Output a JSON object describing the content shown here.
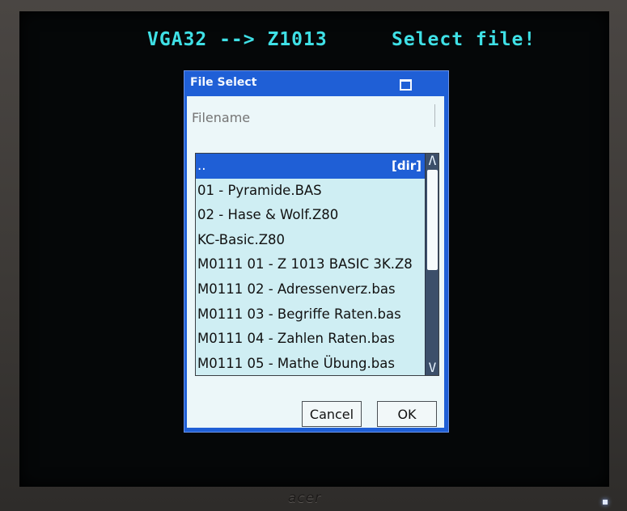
{
  "header": {
    "left": "VGA32 --> Z1013",
    "right": "Select file!"
  },
  "dialog": {
    "title": "File Select",
    "filename_placeholder": "Filename",
    "files": [
      {
        "name": "..",
        "tag": "[dir]",
        "selected": true
      },
      {
        "name": "01 - Pyramide.BAS",
        "tag": ""
      },
      {
        "name": "02 - Hase & Wolf.Z80",
        "tag": ""
      },
      {
        "name": "KC-Basic.Z80",
        "tag": ""
      },
      {
        "name": "M0111 01 - Z 1013 BASIC 3K.Z8",
        "tag": ""
      },
      {
        "name": "M0111 02 - Adressenverz.bas",
        "tag": ""
      },
      {
        "name": "M0111 03 - Begriffe Raten.bas",
        "tag": ""
      },
      {
        "name": "M0111 04 - Zahlen Raten.bas",
        "tag": ""
      },
      {
        "name": "M0111 05 - Mathe Übung.bas",
        "tag": ""
      }
    ],
    "scroll_up": "Λ",
    "scroll_down": "V",
    "cancel_label": "Cancel",
    "ok_label": "OK"
  },
  "monitor": {
    "brand": "acer"
  },
  "colors": {
    "header_text": "#3fe0e6",
    "dialog_frame": "#1f5fd6",
    "list_row": "#cfeef3",
    "selected_row": "#1f5fd6"
  }
}
